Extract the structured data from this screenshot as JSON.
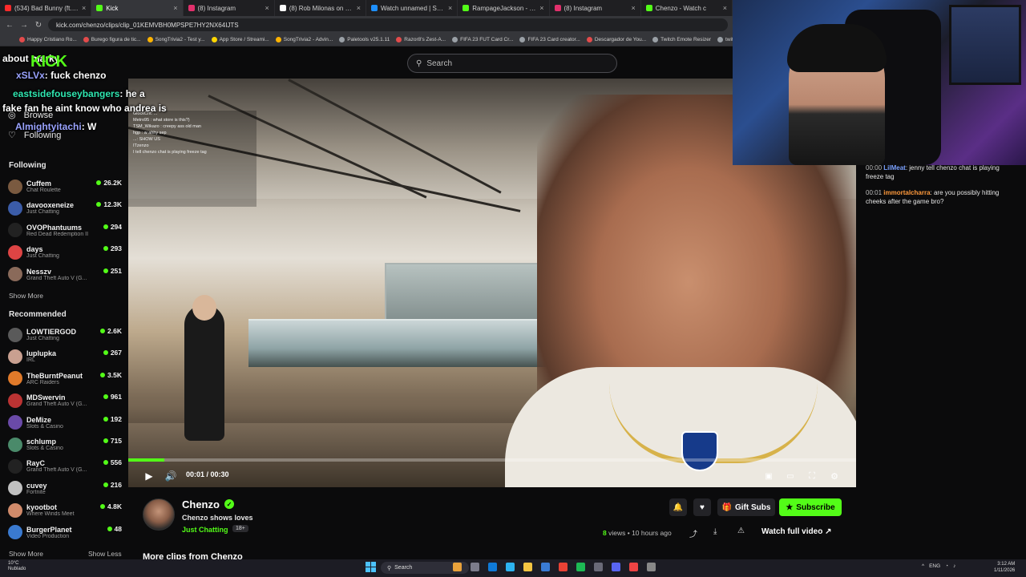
{
  "browser": {
    "tabs": [
      {
        "label": "(534) Bad Bunny (ft. Jhay Cortez)",
        "color": "#ff2b2b"
      },
      {
        "label": "Kick",
        "color": "#53fc18",
        "active": true
      },
      {
        "label": "(8) Instagram",
        "color": "#e1306c"
      },
      {
        "label": "(8) Rob Milonas on X: \"https://",
        "color": "#ffffff"
      },
      {
        "label": "Watch unnamed | Streamable",
        "color": "#1e90ff"
      },
      {
        "label": "RampageJackson - Watch clips",
        "color": "#53fc18"
      },
      {
        "label": "(8) Instagram",
        "color": "#e1306c"
      },
      {
        "label": "Chenzo - Watch c",
        "color": "#53fc18"
      }
    ],
    "url": "kick.com/chenzo/clips/clip_01KEMVBH0MPSPE7HY2NX64IJTS",
    "bookmarks": [
      {
        "label": "Happy Cristiano Ro...",
        "color": "#e34b4b"
      },
      {
        "label": "Burego figura de tic...",
        "color": "#e34b4b"
      },
      {
        "label": "SongTrivia2 - Test y...",
        "color": "#ffb300"
      },
      {
        "label": "App Store / Streami...",
        "color": "#ffd600"
      },
      {
        "label": "SongTrivia2 - Advin...",
        "color": "#ffb300"
      },
      {
        "label": "Paletools v25.1.11",
        "color": "#9aa0a6"
      },
      {
        "label": "Razor8's Zest-A...",
        "color": "#e34b4b"
      },
      {
        "label": "FIFA 23 FUT Card Cr...",
        "color": "#9aa0a6"
      },
      {
        "label": "FIFA 23 Card creator...",
        "color": "#9aa0a6"
      },
      {
        "label": "Descargador de You...",
        "color": "#e34b4b"
      },
      {
        "label": "Twitch Emote Resizer",
        "color": "#9aa0a6"
      },
      {
        "label": "twitch emote r...",
        "color": "#9aa0a6"
      }
    ]
  },
  "header": {
    "logo": "KICK",
    "search_placeholder": "Search"
  },
  "sidebar": {
    "nav": [
      {
        "label": "Browse",
        "icon": "compass-icon"
      },
      {
        "label": "Following",
        "icon": "heart-icon"
      }
    ],
    "following_title": "Following",
    "following": [
      {
        "name": "Cuffem",
        "category": "Chat Roulette",
        "viewers": "26.2K",
        "color": "#7a5a40"
      },
      {
        "name": "davooxeneize",
        "category": "Just Chatting",
        "viewers": "12.3K",
        "color": "#3b5ca8"
      },
      {
        "name": "OVOPhantuums",
        "category": "Red Dead Redemption II",
        "viewers": "294",
        "color": "#222222"
      },
      {
        "name": "days",
        "category": "Just Chatting",
        "viewers": "293",
        "color": "#d44"
      },
      {
        "name": "Nesszv",
        "category": "Grand Theft Auto V (G...",
        "viewers": "251",
        "color": "#8a6a5a"
      }
    ],
    "show_more": "Show More",
    "recommended_title": "Recommended",
    "recommended": [
      {
        "name": "LOWTIERGOD",
        "category": "Just Chatting",
        "viewers": "2.6K",
        "color": "#5a5a5a"
      },
      {
        "name": "luplupka",
        "category": "IRL",
        "viewers": "267",
        "color": "#c9a090"
      },
      {
        "name": "TheBurntPeanut",
        "category": "ARC Raiders",
        "viewers": "3.5K",
        "color": "#e07a2a"
      },
      {
        "name": "MDSwervin",
        "category": "Grand Theft Auto V (G...",
        "viewers": "961",
        "color": "#b33"
      },
      {
        "name": "DeMize",
        "category": "Slots & Casino",
        "viewers": "192",
        "color": "#6a4aa8"
      },
      {
        "name": "schlump",
        "category": "Slots & Casino",
        "viewers": "715",
        "color": "#4a8a6a"
      },
      {
        "name": "RayC",
        "category": "Grand Theft Auto V (G...",
        "viewers": "556",
        "color": "#222"
      },
      {
        "name": "cuvey",
        "category": "Fortnite",
        "viewers": "216",
        "color": "#c0c0c0"
      },
      {
        "name": "kyootbot",
        "category": "Where Winds Meet",
        "viewers": "4.8K",
        "color": "#d08a6a"
      },
      {
        "name": "BurgerPlanet",
        "category": "Video Production",
        "viewers": "48",
        "color": "#3a7ad0"
      }
    ],
    "show_more_bottom": "Show More",
    "show_less": "Show Less"
  },
  "overlay_chat": [
    {
      "user": "",
      "text": "about marky"
    },
    {
      "user": "xSLVx",
      "text": ": fuck chenzo"
    },
    {
      "user": "eastsidefouseybangers",
      "text": ": he a"
    },
    {
      "user": "",
      "text": "fake fan he aint know who andrea is"
    },
    {
      "user": "Almightyitachi",
      "text": ": W"
    }
  ],
  "stream_chat_lines": [
    "GlockCrit: ...",
    "Metro95 : what store is this?)",
    "TSM_Wikazo : creepy ass old man",
    "hgp : w ahhy sep",
    "...: SHOW US",
    "ITzenzo",
    "I tell chenzo chat is playing freeze tag"
  ],
  "player": {
    "time": "00:01 / 00:30",
    "progress": 0.05
  },
  "right_chat": [
    {
      "time": "00:00",
      "user": "LilMeat",
      "text": "jenny tell chenzo chat is playing freeze tag",
      "color": "#7aa0ff"
    },
    {
      "time": "00:01",
      "user": "immortalcharra",
      "text": "are you possibly hitting cheeks after the game bro?",
      "color": "#ff9a3c"
    }
  ],
  "clip_info": {
    "channel": "Chenzo",
    "title": "Chenzo shows loves",
    "category": "Just Chatting",
    "age": "18+",
    "gift_label": "Gift Subs",
    "subscribe_label": "Subscribe",
    "views_count": "8",
    "views_suffix": "views • 10 hours ago",
    "watch_full": "Watch full video",
    "more_clips": "More clips from Chenzo"
  },
  "taskbar": {
    "weather_temp": "10°C",
    "weather_desc": "Nublado",
    "search": "Search",
    "lang": "ENG",
    "time": "3:12 AM",
    "date": "1/11/2026"
  }
}
